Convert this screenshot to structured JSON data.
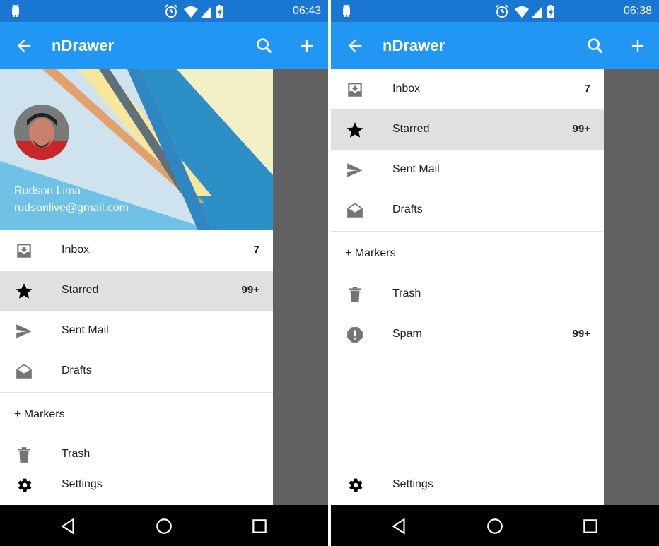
{
  "screens": [
    {
      "status_time": "06:43",
      "app_title": "nDrawer",
      "account": {
        "name": "Rudson Lima",
        "email": "rudsonlive@gmail.com"
      },
      "items": [
        {
          "label": "Inbox",
          "count": "7",
          "icon": "inbox-icon"
        },
        {
          "label": "Starred",
          "count": "99+",
          "icon": "star-icon",
          "selected": true
        },
        {
          "label": "Sent Mail",
          "count": "",
          "icon": "send-icon"
        },
        {
          "label": "Drafts",
          "count": "",
          "icon": "drafts-icon"
        }
      ],
      "markers_label": "+ Markers",
      "trash_label": "Trash",
      "settings_label": "Settings"
    },
    {
      "status_time": "06:38",
      "app_title": "nDrawer",
      "items": [
        {
          "label": "Inbox",
          "count": "7",
          "icon": "inbox-icon"
        },
        {
          "label": "Starred",
          "count": "99+",
          "icon": "star-icon",
          "selected": true
        },
        {
          "label": "Sent Mail",
          "count": "",
          "icon": "send-icon"
        },
        {
          "label": "Drafts",
          "count": "",
          "icon": "drafts-icon"
        }
      ],
      "markers_label": "+ Markers",
      "trash_label": "Trash",
      "spam_label": "Spam",
      "spam_count": "99+",
      "settings_label": "Settings"
    }
  ],
  "colors": {
    "status_bar": "#1976d2",
    "app_bar": "#2196f3",
    "selected_row": "#e0e0e0",
    "scrim": "#616161",
    "nav_bar": "#000000"
  }
}
